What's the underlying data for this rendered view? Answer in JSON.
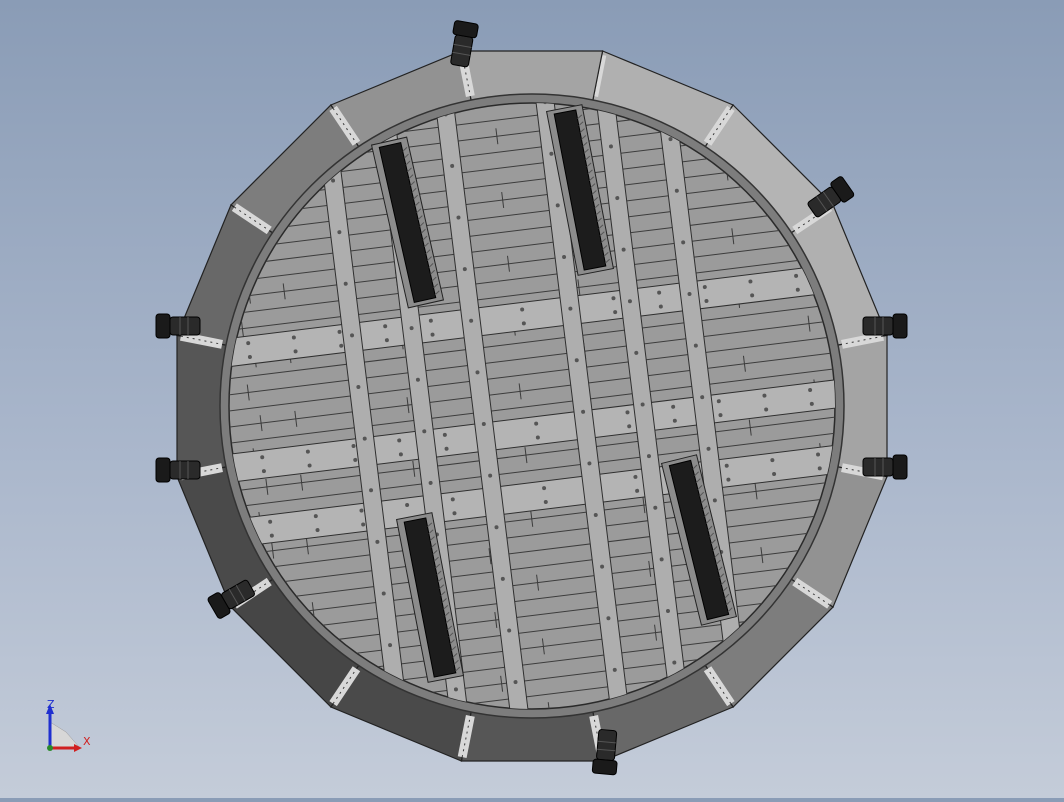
{
  "viewport": {
    "background_top": "#8a9cb6",
    "background_bottom": "#c4ccd9"
  },
  "model": {
    "shell_side_color": "#5e5e5e",
    "shell_top_color": "#a8a8a8",
    "deck_color": "#9a9a9a",
    "beam_color": "#b4b4b4",
    "slot_color": "#1c1c1c",
    "nozzle_color": "#2a2a2a"
  },
  "triad": {
    "axis_z_label": "Z",
    "axis_x_label": "X",
    "z_color": "#1f2fd0",
    "x_color": "#d02020"
  }
}
